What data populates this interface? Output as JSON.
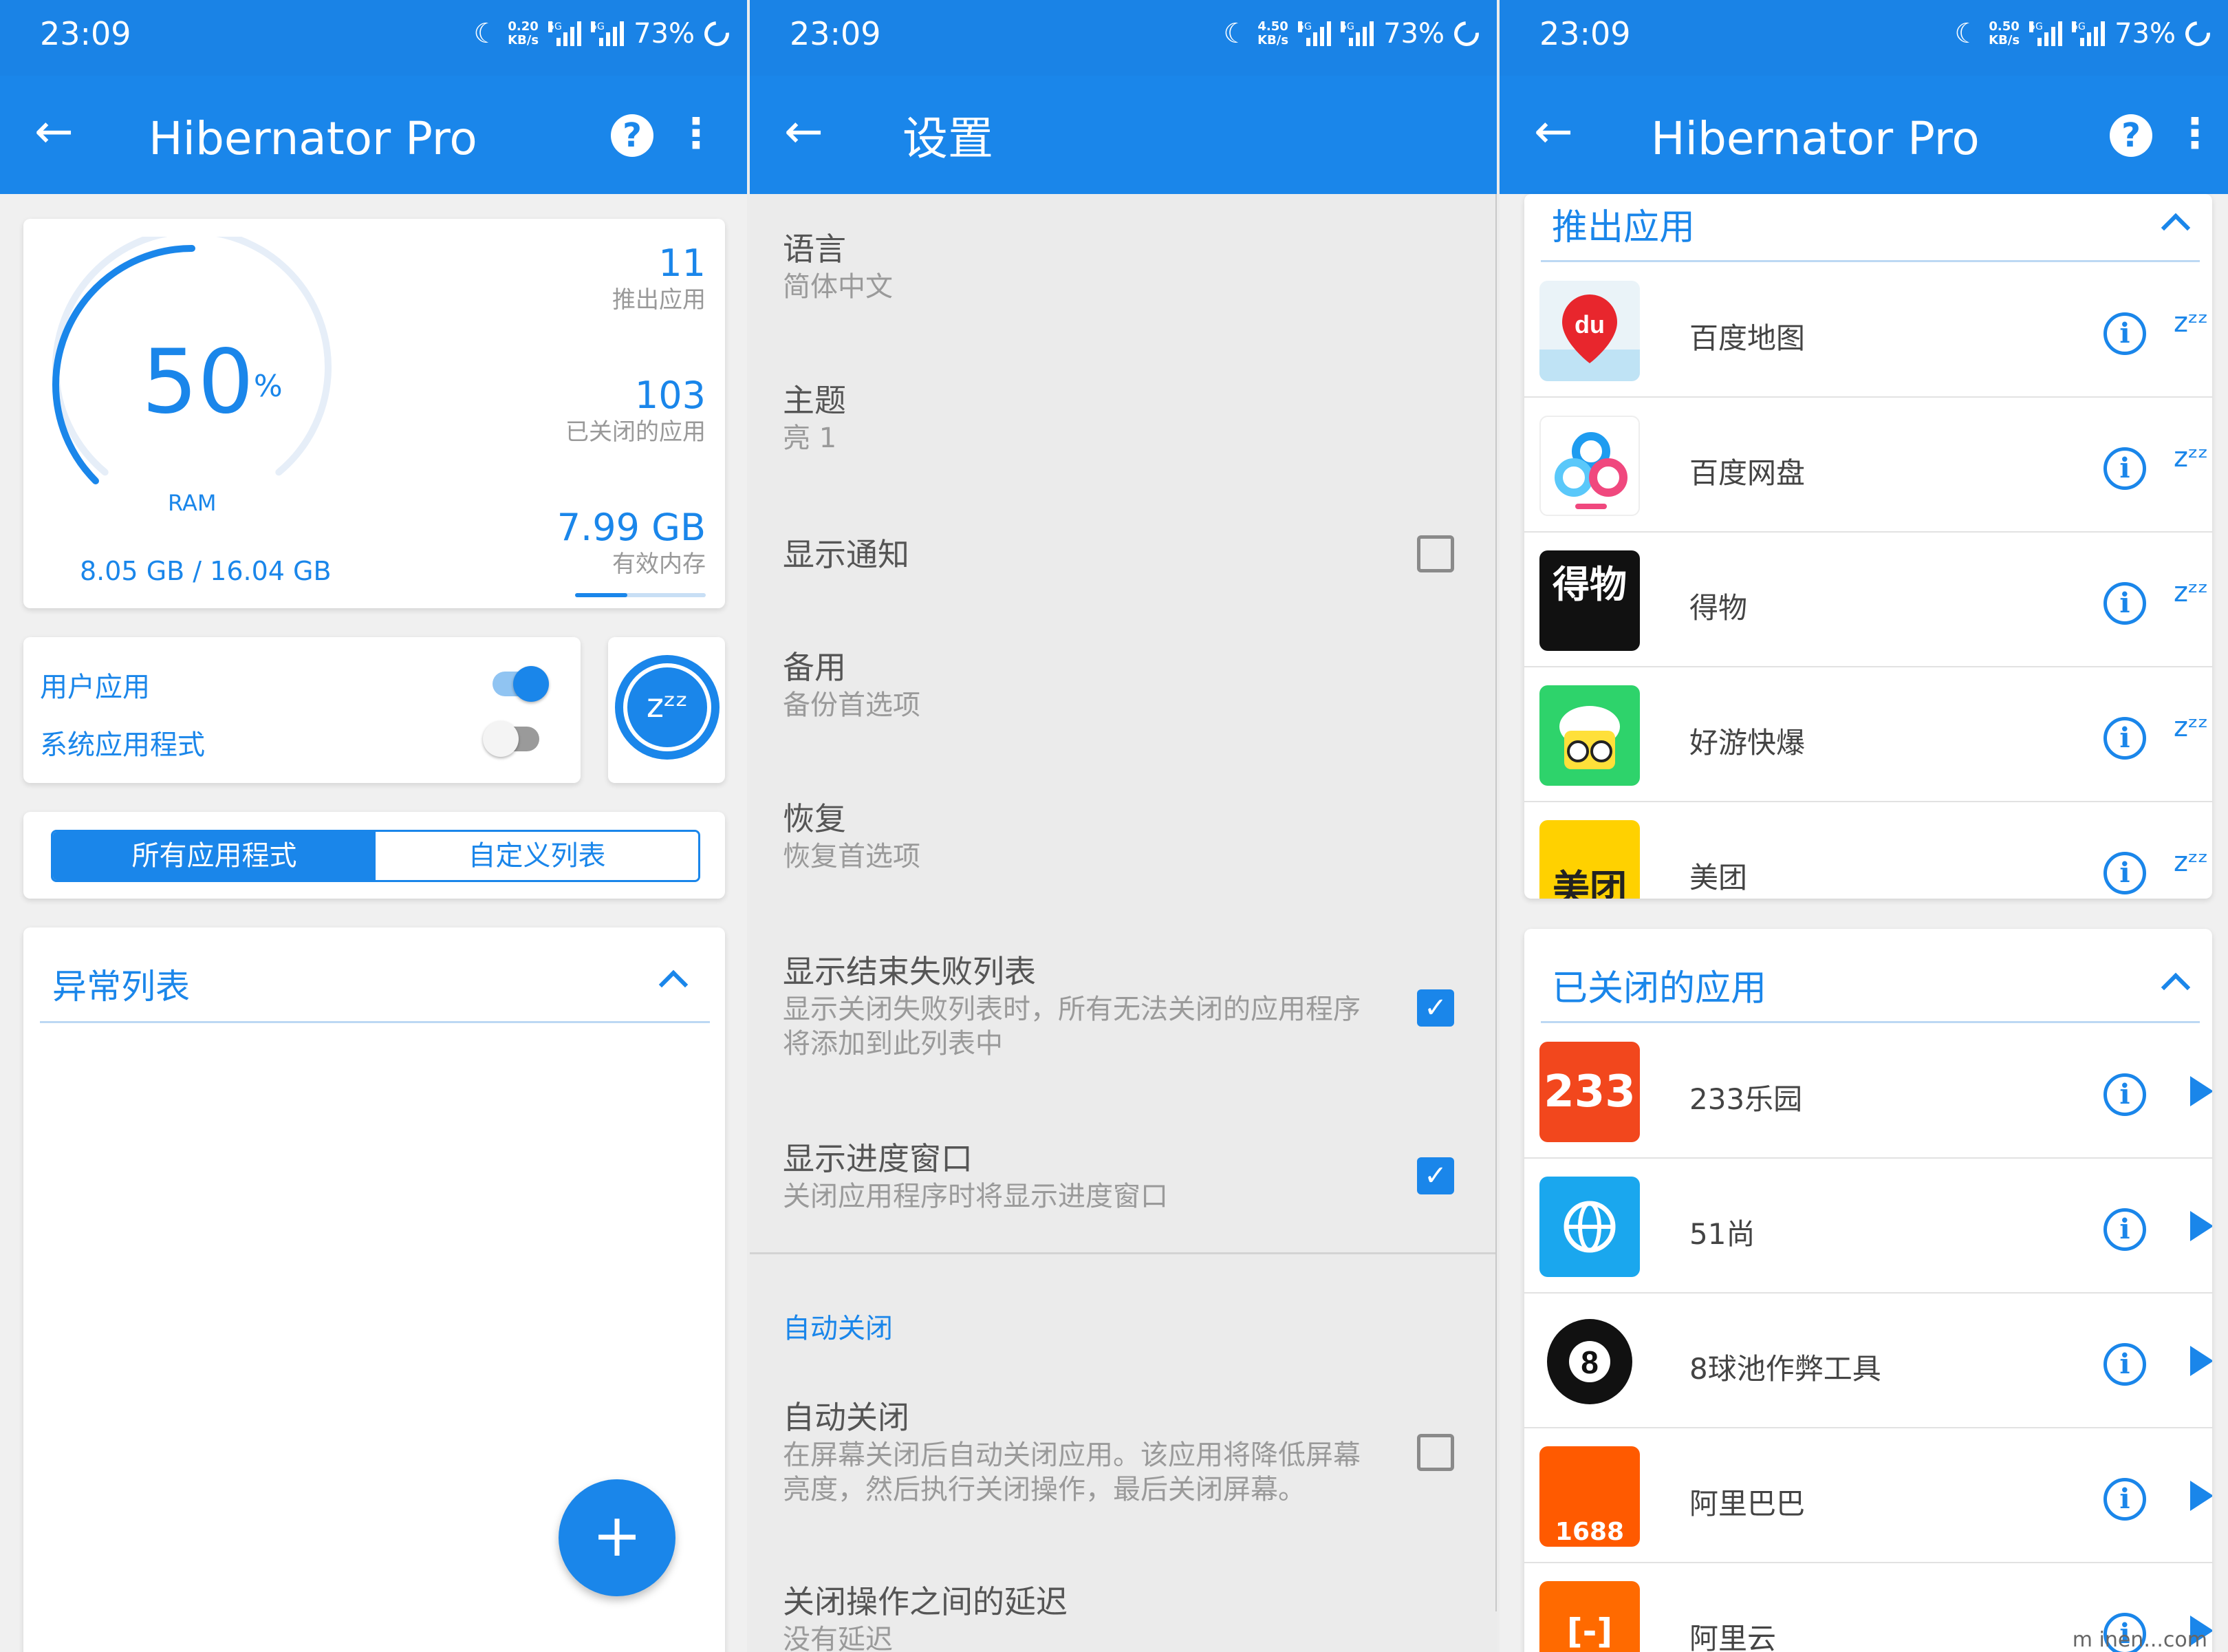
{
  "status": {
    "time": "23:09",
    "speeds": [
      "0.20",
      "4.50",
      "0.50"
    ],
    "speed_unit": "KB/s",
    "net": "5G",
    "battery": "73%"
  },
  "colors": {
    "accent": "#1a86ea",
    "statusbar": "#1a83e6"
  },
  "panel1": {
    "title": "Hibernator Pro",
    "help": "?",
    "gauge": {
      "percent": "50",
      "percent_sign": "%",
      "label": "RAM",
      "fraction": 0.5
    },
    "memory": "8.05 GB / 16.04 GB",
    "stats": [
      {
        "value": "11",
        "label": "推出应用"
      },
      {
        "value": "103",
        "label": "已关闭的应用"
      },
      {
        "value": "7.99 GB",
        "label": "有效内存"
      }
    ],
    "effective_fraction": 0.4,
    "toggles": [
      {
        "label": "用户应用",
        "on": true
      },
      {
        "label": "系统应用程式",
        "on": false
      }
    ],
    "hibernate_icon": "zzz-icon",
    "hibernate_text": "zᶻᶻ",
    "segments": [
      "所有应用程式",
      "自定义列表"
    ],
    "section": "异常列表",
    "fab": "+"
  },
  "panel2": {
    "title": "设置",
    "settings": [
      {
        "title": "语言",
        "sub": "简体中文"
      },
      {
        "title": "主题",
        "sub": "亮 1"
      },
      {
        "title": "显示通知",
        "checked": false
      },
      {
        "title": "备用",
        "sub": "备份首选项"
      },
      {
        "title": "恢复",
        "sub": "恢复首选项"
      },
      {
        "title": "显示结束失败列表",
        "sub": "显示关闭失败列表时，所有无法关闭的应用程序将添加到此列表中",
        "checked": true
      },
      {
        "title": "显示进度窗口",
        "sub": "关闭应用程序时将显示进度窗口",
        "checked": true
      }
    ],
    "group": "自动关闭",
    "settings2": [
      {
        "title": "自动关闭",
        "sub": "在屏幕关闭后自动关闭应用。该应用将降低屏幕亮度，然后执行关闭操作，最后关闭屏幕。",
        "checked": false
      },
      {
        "title": "关闭操作之间的延迟",
        "sub": "没有延迟"
      }
    ],
    "check_mark": "✓"
  },
  "panel3": {
    "title": "Hibernator Pro",
    "help": "?",
    "section1": "推出应用",
    "apps1": [
      {
        "name": "百度地图",
        "icon_text": "du"
      },
      {
        "name": "百度网盘",
        "icon_text": ""
      },
      {
        "name": "得物",
        "icon_text": "得物"
      },
      {
        "name": "好游快爆",
        "icon_text": ""
      },
      {
        "name": "美团",
        "icon_text": "美团"
      }
    ],
    "section2": "已关闭的应用",
    "apps2": [
      {
        "name": "233乐园",
        "icon_text": "233"
      },
      {
        "name": "51尚",
        "icon_text": ""
      },
      {
        "name": "8球池作弊工具",
        "icon_text": "8"
      },
      {
        "name": "阿里巴巴",
        "icon_text": "1688"
      },
      {
        "name": "阿里云",
        "icon_text": "[-]"
      }
    ],
    "info_glyph": "i",
    "zz_glyph": "zᶻᶻ",
    "watermark": "m inen...com"
  }
}
